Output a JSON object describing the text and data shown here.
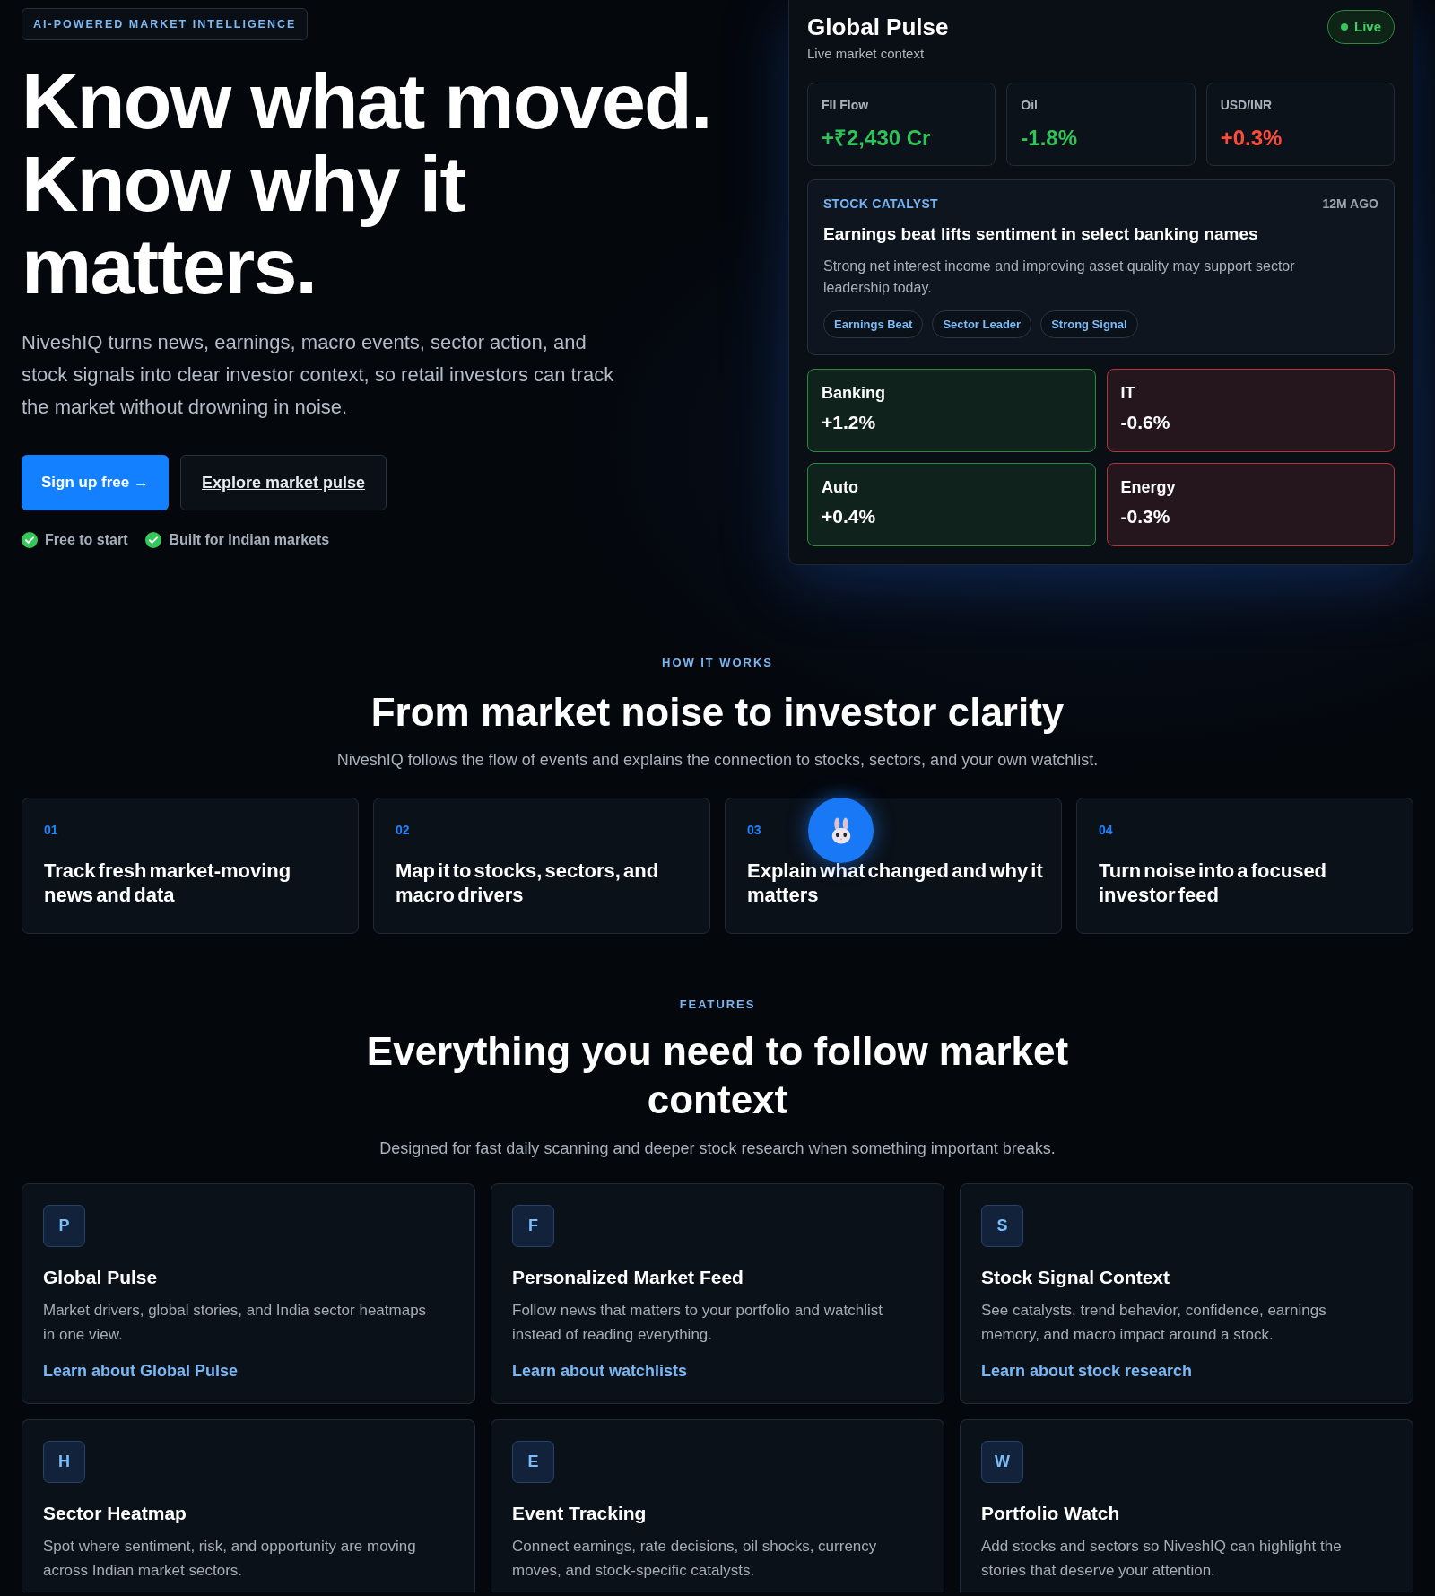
{
  "hero": {
    "badge": "AI-POWERED MARKET INTELLIGENCE",
    "headline": "Know what moved. Know why it matters.",
    "description": "NiveshIQ turns news, earnings, macro events, sector action, and stock signals into clear investor context, so retail investors can track the market without drowning in noise.",
    "buttons": [
      {
        "label": "Sign up free →",
        "kind": "primary"
      },
      {
        "label": "Explore market pulse",
        "kind": "outline"
      }
    ],
    "highlights": [
      "Free to start",
      "Built for Indian markets"
    ]
  },
  "global_pulse": {
    "title": "Global Pulse",
    "subtitle": "Live market context",
    "status": "Live",
    "metrics": [
      {
        "label": "FII Flow",
        "value": "+₹2,430 Cr",
        "color": "#2fc35a"
      },
      {
        "label": "Oil",
        "value": "-1.8%",
        "color": "#2fc35a"
      },
      {
        "label": "USD/INR",
        "value": "+0.3%",
        "color": "#ff4b3a"
      }
    ],
    "catalyst": {
      "label": "STOCK CATALYST",
      "time": "12M AGO",
      "headline": "Earnings beat lifts sentiment in select banking names",
      "summary": "Strong net interest income and improving asset quality may support sector leadership today.",
      "tags": [
        "Earnings Beat",
        "Sector Leader",
        "Strong Signal"
      ]
    },
    "sectors": [
      {
        "name": "Banking",
        "change": "+1.2%",
        "color": "#2a8a3e"
      },
      {
        "name": "IT",
        "change": "-0.6%",
        "color": "#b3343a"
      },
      {
        "name": "Auto",
        "change": "+0.4%",
        "color": "#2a8a3e"
      },
      {
        "name": "Energy",
        "change": "-0.3%",
        "color": "#b3343a"
      }
    ]
  },
  "how_it_works": {
    "eyebrow": "HOW IT WORKS",
    "title": "From market noise to investor clarity",
    "subtitle": "NiveshIQ follows the flow of events and explains the connection to stocks, sectors, and your own watchlist.",
    "steps": [
      {
        "number": "01",
        "title": "Track fresh market-moving news and data"
      },
      {
        "number": "02",
        "title": "Map it to stocks, sectors, and macro drivers"
      },
      {
        "number": "03",
        "title": "Explain what changed and why it matters"
      },
      {
        "number": "04",
        "title": "Turn noise into a focused investor feed"
      }
    ]
  },
  "features": {
    "eyebrow": "FEATURES",
    "title": "Everything you need to follow market context",
    "subtitle": "Designed for fast daily scanning and deeper stock research when something important breaks.",
    "items": [
      {
        "letter": "P",
        "title": "Global Pulse",
        "description": "Market drivers, global stories, and India sector heatmaps in one view.",
        "link": "Learn about Global Pulse"
      },
      {
        "letter": "F",
        "title": "Personalized Market Feed",
        "description": "Follow news that matters to your portfolio and watchlist instead of reading everything.",
        "link": "Learn about watchlists"
      },
      {
        "letter": "S",
        "title": "Stock Signal Context",
        "description": "See catalysts, trend behavior, confidence, earnings memory, and macro impact around a stock.",
        "link": "Learn about stock research"
      },
      {
        "letter": "H",
        "title": "Sector Heatmap",
        "description": "Spot where sentiment, risk, and opportunity are moving across Indian market sectors."
      },
      {
        "letter": "E",
        "title": "Event Tracking",
        "description": "Connect earnings, rate decisions, oil shocks, currency moves, and stock-specific catalysts."
      },
      {
        "letter": "W",
        "title": "Portfolio Watch",
        "description": "Add stocks and sectors so NiveshIQ can highlight the stories that deserve your attention."
      }
    ]
  }
}
